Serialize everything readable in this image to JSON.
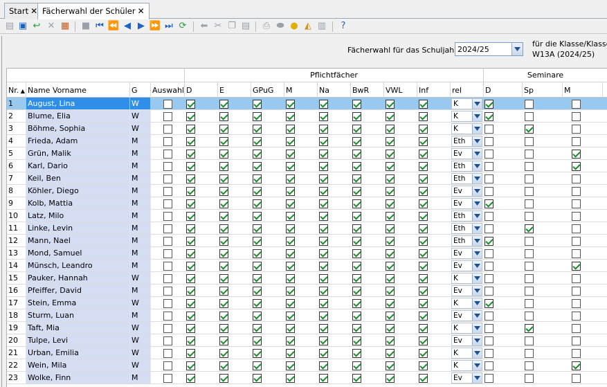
{
  "tabs": [
    {
      "label": "Start",
      "active": false
    },
    {
      "label": "Fächerwahl der Schüler",
      "active": true
    }
  ],
  "toolbar": {
    "icons": [
      "new-icon",
      "save-icon",
      "undo-icon",
      "delete-icon",
      "edit-icon",
      "stack-icon",
      "first-icon",
      "prev-page-icon",
      "prev-icon",
      "next-icon",
      "next-page-icon",
      "last-icon",
      "refresh-icon",
      "back-icon",
      "cut-icon",
      "copy-icon",
      "paste-icon",
      "print-icon",
      "preview-icon",
      "bulb-icon",
      "broom-icon",
      "export-icon",
      "help-icon"
    ]
  },
  "header": {
    "year_label": "Fächerwahl für das Schuljahr",
    "year_value": "2024/25",
    "klasse_label": "für die Klasse/Klassen",
    "klasse_value": "W13A (2024/25)"
  },
  "grid": {
    "groups": {
      "pflicht": "Pflichtfächer",
      "seminare": "Seminare"
    },
    "columns": [
      "Nr.",
      "Name Vorname",
      "G",
      "Auswahl",
      "D",
      "E",
      "GPuG",
      "M",
      "Na",
      "BwR",
      "VWL",
      "Inf",
      "rel",
      "D",
      "Sp",
      "M"
    ],
    "rows": [
      {
        "nr": "1",
        "name": "August, Lina",
        "g": "W",
        "auswahl": false,
        "rel": "K",
        "sem": [
          true,
          false,
          false
        ],
        "selected": true
      },
      {
        "nr": "2",
        "name": "Blume, Elia",
        "g": "W",
        "auswahl": false,
        "rel": "K",
        "sem": [
          true,
          false,
          false
        ]
      },
      {
        "nr": "3",
        "name": "Böhme, Sophia",
        "g": "W",
        "auswahl": false,
        "rel": "K",
        "sem": [
          false,
          true,
          false
        ]
      },
      {
        "nr": "4",
        "name": "Frieda, Adam",
        "g": "M",
        "auswahl": false,
        "rel": "Eth",
        "sem": [
          false,
          false,
          false
        ]
      },
      {
        "nr": "5",
        "name": "Grün, Malik",
        "g": "M",
        "auswahl": false,
        "rel": "Ev",
        "sem": [
          false,
          false,
          true
        ]
      },
      {
        "nr": "6",
        "name": "Karl, Dario",
        "g": "M",
        "auswahl": false,
        "rel": "Eth",
        "sem": [
          false,
          false,
          true
        ]
      },
      {
        "nr": "7",
        "name": "Keil, Ben",
        "g": "M",
        "auswahl": false,
        "rel": "Eth",
        "sem": [
          false,
          false,
          false
        ]
      },
      {
        "nr": "8",
        "name": "Köhler, Diego",
        "g": "M",
        "auswahl": false,
        "rel": "Ev",
        "sem": [
          false,
          false,
          false
        ]
      },
      {
        "nr": "9",
        "name": "Kolb, Mattia",
        "g": "M",
        "auswahl": false,
        "rel": "Ev",
        "sem": [
          true,
          false,
          false
        ]
      },
      {
        "nr": "10",
        "name": "Latz, Milo",
        "g": "M",
        "auswahl": false,
        "rel": "Eth",
        "sem": [
          false,
          false,
          false
        ]
      },
      {
        "nr": "11",
        "name": "Linke, Levin",
        "g": "M",
        "auswahl": false,
        "rel": "Eth",
        "sem": [
          false,
          true,
          false
        ]
      },
      {
        "nr": "12",
        "name": "Mann, Nael",
        "g": "M",
        "auswahl": false,
        "rel": "Eth",
        "sem": [
          true,
          false,
          false
        ]
      },
      {
        "nr": "13",
        "name": "Mond, Samuel",
        "g": "M",
        "auswahl": false,
        "rel": "Ev",
        "sem": [
          false,
          false,
          false
        ]
      },
      {
        "nr": "14",
        "name": "Münsch, Leandro",
        "g": "M",
        "auswahl": false,
        "rel": "Ev",
        "sem": [
          false,
          false,
          true
        ]
      },
      {
        "nr": "15",
        "name": "Pauker, Hannah",
        "g": "W",
        "auswahl": false,
        "rel": "K",
        "sem": [
          false,
          false,
          false
        ]
      },
      {
        "nr": "16",
        "name": "Pfeiffer, David",
        "g": "M",
        "auswahl": false,
        "rel": "Ev",
        "sem": [
          false,
          false,
          false
        ]
      },
      {
        "nr": "17",
        "name": "Stein, Emma",
        "g": "W",
        "auswahl": false,
        "rel": "K",
        "sem": [
          true,
          false,
          false
        ]
      },
      {
        "nr": "18",
        "name": "Sturm, Luan",
        "g": "M",
        "auswahl": false,
        "rel": "Ev",
        "sem": [
          false,
          false,
          false
        ]
      },
      {
        "nr": "19",
        "name": "Taft, Mia",
        "g": "W",
        "auswahl": false,
        "rel": "K",
        "sem": [
          false,
          true,
          false
        ]
      },
      {
        "nr": "20",
        "name": "Tulpe, Levi",
        "g": "W",
        "auswahl": false,
        "rel": "Ev",
        "sem": [
          false,
          false,
          false
        ]
      },
      {
        "nr": "21",
        "name": "Urban, Emilia",
        "g": "W",
        "auswahl": false,
        "rel": "K",
        "sem": [
          false,
          false,
          false
        ]
      },
      {
        "nr": "22",
        "name": "Wein, Mila",
        "g": "W",
        "auswahl": false,
        "rel": "K",
        "sem": [
          false,
          false,
          true
        ]
      },
      {
        "nr": "23",
        "name": "Wolke, Finn",
        "g": "M",
        "auswahl": false,
        "rel": "Ev",
        "sem": [
          false,
          false,
          false
        ]
      }
    ],
    "pflicht_all_checked": true
  }
}
